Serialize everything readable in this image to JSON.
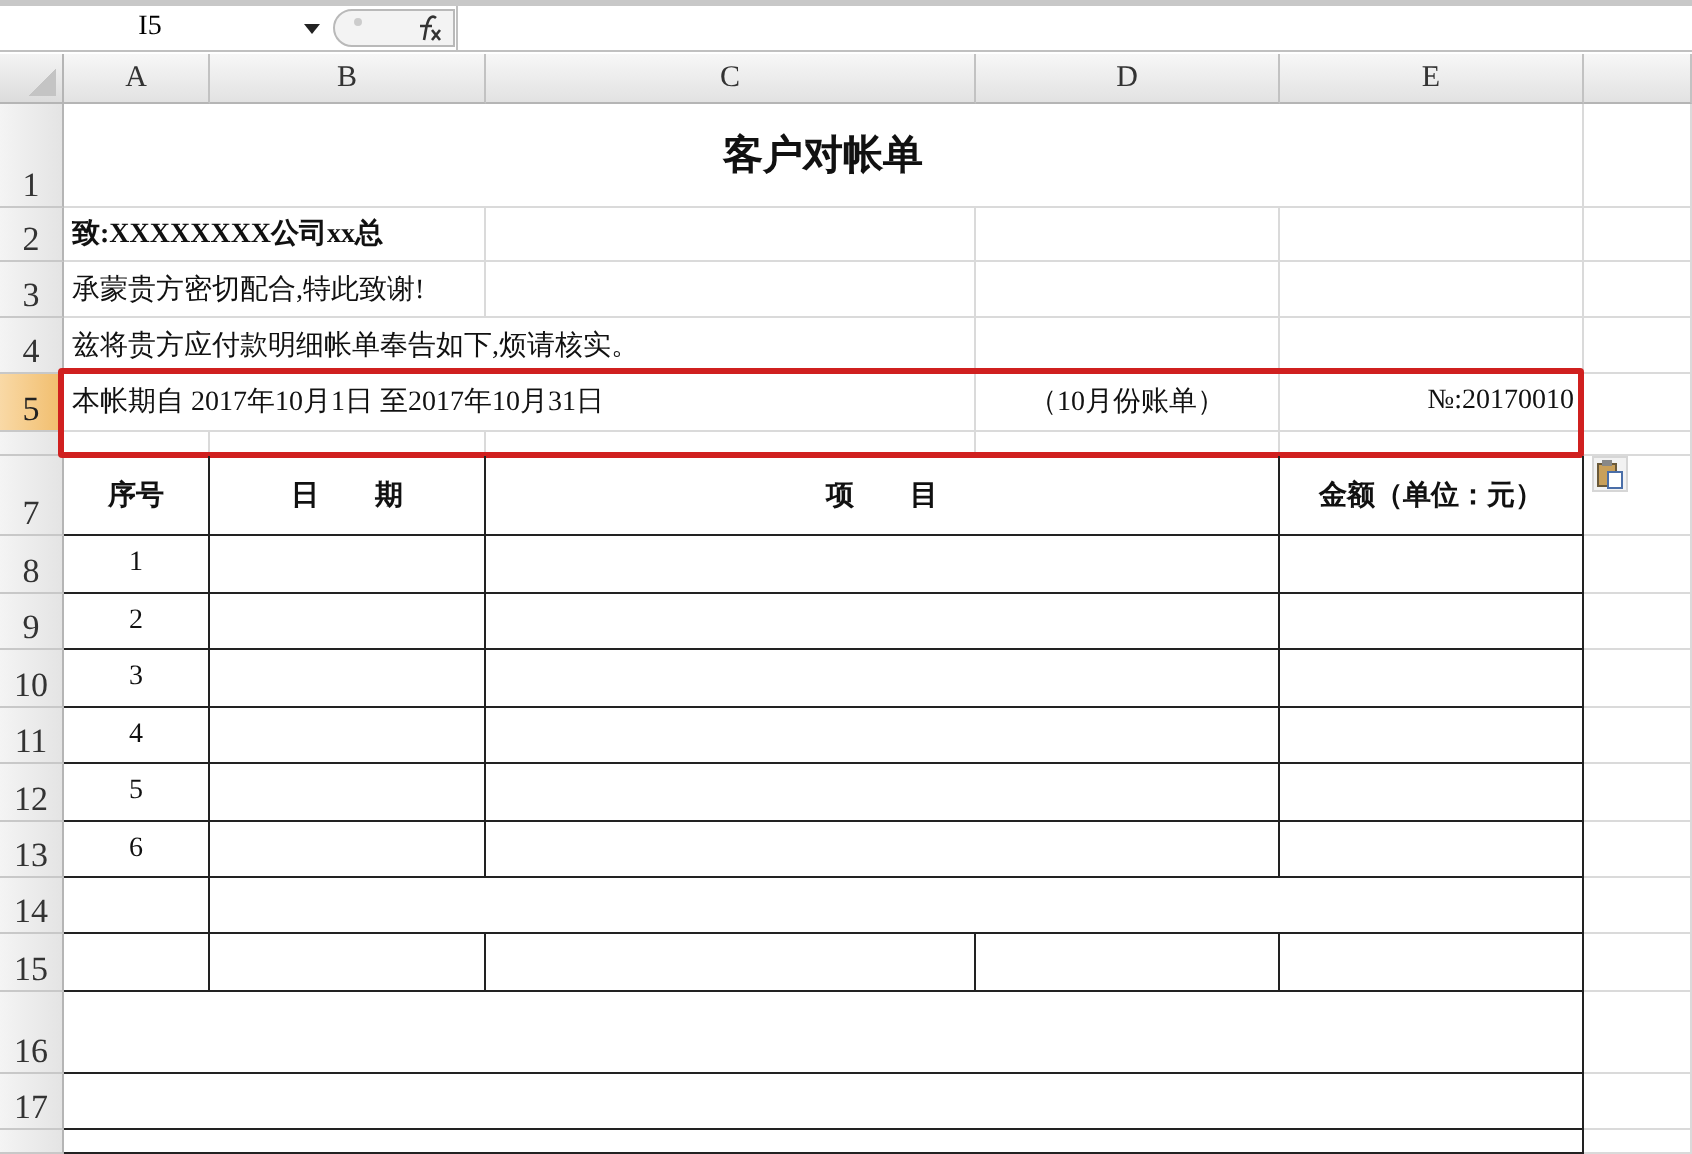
{
  "formula_bar": {
    "name_box": "I5"
  },
  "columns": [
    "A",
    "B",
    "C",
    "D",
    "E"
  ],
  "row_headers": [
    {
      "label": "1",
      "selected": false
    },
    {
      "label": "2",
      "selected": false
    },
    {
      "label": "3",
      "selected": false
    },
    {
      "label": "4",
      "selected": false
    },
    {
      "label": "5",
      "selected": true
    },
    {
      "selected": false
    },
    {
      "label": "7",
      "selected": false
    },
    {
      "label": "8",
      "selected": false
    },
    {
      "label": "9",
      "selected": false
    },
    {
      "label": "10",
      "selected": false
    },
    {
      "label": "11",
      "selected": false
    },
    {
      "label": "12",
      "selected": false
    },
    {
      "label": "13",
      "selected": false
    },
    {
      "label": "14",
      "selected": false
    },
    {
      "label": "15",
      "selected": false
    },
    {
      "label": "16",
      "selected": false
    },
    {
      "label": "17",
      "selected": false
    },
    {
      "selected": false
    }
  ],
  "title": "客户对帐单",
  "lines": [
    {
      "text": "致:XXXXXXXX公司xx总",
      "bold": true
    },
    {
      "text": "承蒙贵方密切配合,特此致谢!",
      "bold": false
    },
    {
      "text": "兹将贵方应付款明细帐单奉告如下,烦请核实。",
      "bold": false
    }
  ],
  "period": {
    "range": "本帐期自  2017年10月1日  至2017年10月31日",
    "month": "（10月份账单）",
    "number": "№:20170010",
    "framed": true
  },
  "table": {
    "columns": [
      "序号",
      "日　　期",
      "项　　目",
      "金额（单位：元）"
    ],
    "rows": [
      {
        "index": "1"
      },
      {
        "index": "2"
      },
      {
        "index": "3"
      },
      {
        "index": "4"
      },
      {
        "index": "5"
      },
      {
        "index": "6"
      }
    ]
  }
}
